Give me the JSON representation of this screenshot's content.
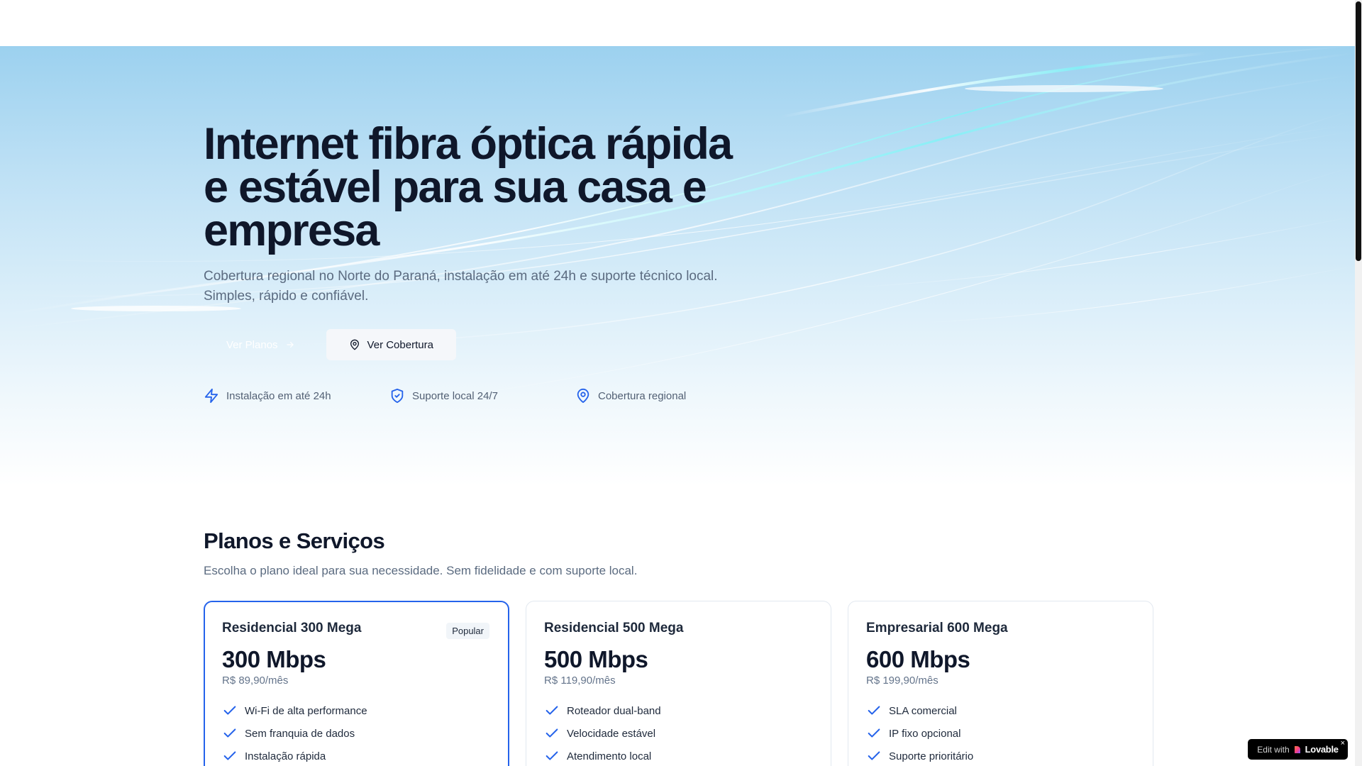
{
  "hero": {
    "title": "Internet fibra óptica rápida e estável para sua casa e empresa",
    "subtitle": "Cobertura regional no Norte do Paraná, instalação em até 24h e suporte técnico local. Simples, rápido e confiável.",
    "primary_button": "Ver Planos",
    "secondary_button": "Ver Cobertura",
    "features": [
      {
        "icon": "lightning-icon",
        "label": "Instalação em até 24h"
      },
      {
        "icon": "shield-check-icon",
        "label": "Suporte local 24/7"
      },
      {
        "icon": "map-pin-icon",
        "label": "Cobertura regional"
      }
    ]
  },
  "plans": {
    "title": "Planos e Serviços",
    "subtitle": "Escolha o plano ideal para sua necessidade. Sem fidelidade e com suporte local.",
    "cards": [
      {
        "name": "Residencial 300 Mega",
        "badge": "Popular",
        "speed": "300 Mbps",
        "price": "R$ 89,90/mês",
        "features": [
          "Wi-Fi de alta performance",
          "Sem franquia de dados",
          "Instalação rápida"
        ]
      },
      {
        "name": "Residencial 500 Mega",
        "speed": "500 Mbps",
        "price": "R$ 119,90/mês",
        "features": [
          "Roteador dual-band",
          "Velocidade estável",
          "Atendimento local"
        ]
      },
      {
        "name": "Empresarial 600 Mega",
        "speed": "600 Mbps",
        "price": "R$ 199,90/mês",
        "features": [
          "SLA comercial",
          "IP fixo opcional",
          "Suporte prioritário"
        ]
      }
    ]
  },
  "lovable_badge": {
    "prefix": "Edit with",
    "brand": "Lovable",
    "close": "×"
  },
  "colors": {
    "accent": "#2563eb",
    "text_dark": "#0f172a",
    "text_muted": "#5b6b80"
  }
}
